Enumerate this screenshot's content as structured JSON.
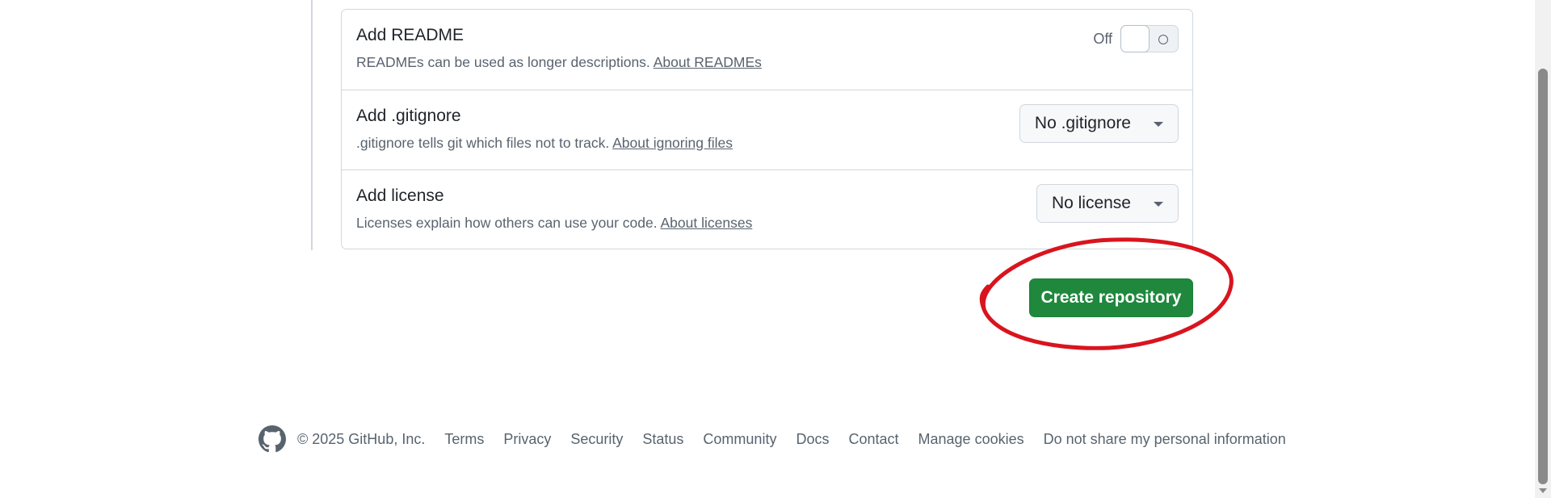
{
  "options": {
    "readme": {
      "title": "Add README",
      "description": "READMEs can be used as longer descriptions.",
      "link": "About READMEs",
      "toggle_label": "Off",
      "toggle_state": "off"
    },
    "gitignore": {
      "title": "Add .gitignore",
      "description": ".gitignore tells git which files not to track.",
      "link": "About ignoring files",
      "selected": "No .gitignore"
    },
    "license": {
      "title": "Add license",
      "description": "Licenses explain how others can use your code.",
      "link": "About licenses",
      "selected": "No license"
    }
  },
  "create_button": {
    "label": "Create repository",
    "color": "#1f883d"
  },
  "annotation": {
    "shape": "hand-drawn-circle",
    "color": "#d9141e"
  },
  "footer": {
    "logo_icon": "github-mark-icon",
    "copyright": "© 2025 GitHub, Inc.",
    "links": [
      "Terms",
      "Privacy",
      "Security",
      "Status",
      "Community",
      "Docs",
      "Contact",
      "Manage cookies",
      "Do not share my personal information"
    ]
  }
}
